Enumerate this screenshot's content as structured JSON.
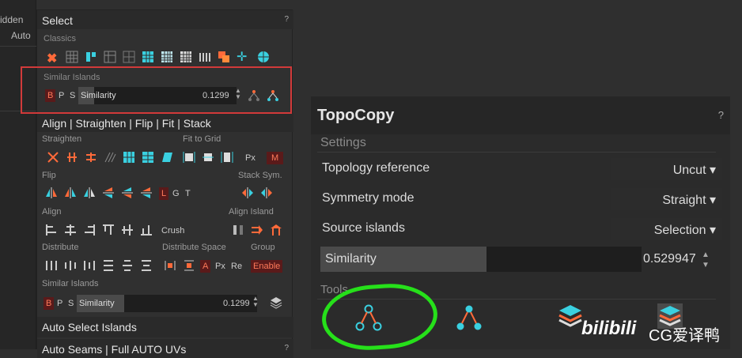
{
  "left_strip": {
    "tab1": "idden",
    "tab2": "Auto"
  },
  "select_panel": {
    "title": "Select",
    "help": "?",
    "classics_label": "Classics",
    "similar_label": "Similar Islands",
    "bps": [
      "B",
      "P",
      "S"
    ],
    "similarity_label": "Similarity",
    "similarity_value": "0.1299"
  },
  "align_panel": {
    "title": "Align | Straighten | Flip | Fit | Stack",
    "straighten": "Straighten",
    "fit_to_grid": "Fit to Grid",
    "px": "Px",
    "m": "M",
    "flip": "Flip",
    "stack_sym": "Stack Sym.",
    "lgt": [
      "L",
      "G",
      "T"
    ],
    "align": "Align",
    "align_island": "Align Island",
    "crush": "Crush",
    "distribute": "Distribute",
    "distribute_space": "Distribute Space",
    "group": "Group",
    "a": "A",
    "re": "Re",
    "enable": "Enable",
    "similar_label": "Similar Islands",
    "similarity_label": "Similarity",
    "similarity_value": "0.1299"
  },
  "auto_select": {
    "title": "Auto Select Islands"
  },
  "auto_seams": {
    "title": "Auto Seams | Full AUTO UVs",
    "help": "?"
  },
  "topocopy": {
    "title": "TopoCopy",
    "help": "?",
    "settings": "Settings",
    "rows": [
      {
        "label": "Topology reference",
        "value": "Uncut"
      },
      {
        "label": "Symmetry mode",
        "value": "Straight"
      },
      {
        "label": "Source islands",
        "value": "Selection"
      }
    ],
    "similarity_label": "Similarity",
    "similarity_value": "0.529947",
    "tools": "Tools"
  },
  "watermark": {
    "logo": "bilibili",
    "text": "CG爱译鸭"
  },
  "colors": {
    "accent": "#ff6a3a",
    "cyan": "#3ad0e0",
    "highlight": "#26e01a",
    "redbox": "#d23a3a"
  }
}
